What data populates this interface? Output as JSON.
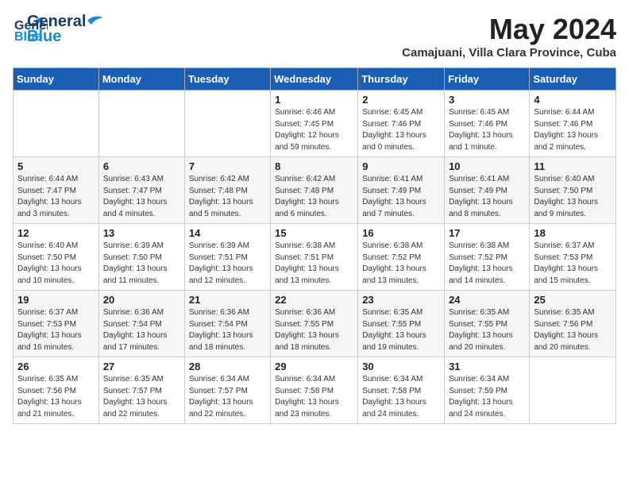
{
  "header": {
    "logo_line1": "General",
    "logo_line2": "Blue",
    "month_year": "May 2024",
    "location": "Camajuani, Villa Clara Province, Cuba"
  },
  "columns": [
    "Sunday",
    "Monday",
    "Tuesday",
    "Wednesday",
    "Thursday",
    "Friday",
    "Saturday"
  ],
  "weeks": [
    [
      {
        "day": "",
        "info": ""
      },
      {
        "day": "",
        "info": ""
      },
      {
        "day": "",
        "info": ""
      },
      {
        "day": "1",
        "info": "Sunrise: 6:46 AM\nSunset: 7:45 PM\nDaylight: 12 hours\nand 59 minutes."
      },
      {
        "day": "2",
        "info": "Sunrise: 6:45 AM\nSunset: 7:46 PM\nDaylight: 13 hours\nand 0 minutes."
      },
      {
        "day": "3",
        "info": "Sunrise: 6:45 AM\nSunset: 7:46 PM\nDaylight: 13 hours\nand 1 minute."
      },
      {
        "day": "4",
        "info": "Sunrise: 6:44 AM\nSunset: 7:46 PM\nDaylight: 13 hours\nand 2 minutes."
      }
    ],
    [
      {
        "day": "5",
        "info": "Sunrise: 6:44 AM\nSunset: 7:47 PM\nDaylight: 13 hours\nand 3 minutes."
      },
      {
        "day": "6",
        "info": "Sunrise: 6:43 AM\nSunset: 7:47 PM\nDaylight: 13 hours\nand 4 minutes."
      },
      {
        "day": "7",
        "info": "Sunrise: 6:42 AM\nSunset: 7:48 PM\nDaylight: 13 hours\nand 5 minutes."
      },
      {
        "day": "8",
        "info": "Sunrise: 6:42 AM\nSunset: 7:48 PM\nDaylight: 13 hours\nand 6 minutes."
      },
      {
        "day": "9",
        "info": "Sunrise: 6:41 AM\nSunset: 7:49 PM\nDaylight: 13 hours\nand 7 minutes."
      },
      {
        "day": "10",
        "info": "Sunrise: 6:41 AM\nSunset: 7:49 PM\nDaylight: 13 hours\nand 8 minutes."
      },
      {
        "day": "11",
        "info": "Sunrise: 6:40 AM\nSunset: 7:50 PM\nDaylight: 13 hours\nand 9 minutes."
      }
    ],
    [
      {
        "day": "12",
        "info": "Sunrise: 6:40 AM\nSunset: 7:50 PM\nDaylight: 13 hours\nand 10 minutes."
      },
      {
        "day": "13",
        "info": "Sunrise: 6:39 AM\nSunset: 7:50 PM\nDaylight: 13 hours\nand 11 minutes."
      },
      {
        "day": "14",
        "info": "Sunrise: 6:39 AM\nSunset: 7:51 PM\nDaylight: 13 hours\nand 12 minutes."
      },
      {
        "day": "15",
        "info": "Sunrise: 6:38 AM\nSunset: 7:51 PM\nDaylight: 13 hours\nand 13 minutes."
      },
      {
        "day": "16",
        "info": "Sunrise: 6:38 AM\nSunset: 7:52 PM\nDaylight: 13 hours\nand 13 minutes."
      },
      {
        "day": "17",
        "info": "Sunrise: 6:38 AM\nSunset: 7:52 PM\nDaylight: 13 hours\nand 14 minutes."
      },
      {
        "day": "18",
        "info": "Sunrise: 6:37 AM\nSunset: 7:53 PM\nDaylight: 13 hours\nand 15 minutes."
      }
    ],
    [
      {
        "day": "19",
        "info": "Sunrise: 6:37 AM\nSunset: 7:53 PM\nDaylight: 13 hours\nand 16 minutes."
      },
      {
        "day": "20",
        "info": "Sunrise: 6:36 AM\nSunset: 7:54 PM\nDaylight: 13 hours\nand 17 minutes."
      },
      {
        "day": "21",
        "info": "Sunrise: 6:36 AM\nSunset: 7:54 PM\nDaylight: 13 hours\nand 18 minutes."
      },
      {
        "day": "22",
        "info": "Sunrise: 6:36 AM\nSunset: 7:55 PM\nDaylight: 13 hours\nand 18 minutes."
      },
      {
        "day": "23",
        "info": "Sunrise: 6:35 AM\nSunset: 7:55 PM\nDaylight: 13 hours\nand 19 minutes."
      },
      {
        "day": "24",
        "info": "Sunrise: 6:35 AM\nSunset: 7:55 PM\nDaylight: 13 hours\nand 20 minutes."
      },
      {
        "day": "25",
        "info": "Sunrise: 6:35 AM\nSunset: 7:56 PM\nDaylight: 13 hours\nand 20 minutes."
      }
    ],
    [
      {
        "day": "26",
        "info": "Sunrise: 6:35 AM\nSunset: 7:56 PM\nDaylight: 13 hours\nand 21 minutes."
      },
      {
        "day": "27",
        "info": "Sunrise: 6:35 AM\nSunset: 7:57 PM\nDaylight: 13 hours\nand 22 minutes."
      },
      {
        "day": "28",
        "info": "Sunrise: 6:34 AM\nSunset: 7:57 PM\nDaylight: 13 hours\nand 22 minutes."
      },
      {
        "day": "29",
        "info": "Sunrise: 6:34 AM\nSunset: 7:58 PM\nDaylight: 13 hours\nand 23 minutes."
      },
      {
        "day": "30",
        "info": "Sunrise: 6:34 AM\nSunset: 7:58 PM\nDaylight: 13 hours\nand 24 minutes."
      },
      {
        "day": "31",
        "info": "Sunrise: 6:34 AM\nSunset: 7:59 PM\nDaylight: 13 hours\nand 24 minutes."
      },
      {
        "day": "",
        "info": ""
      }
    ]
  ]
}
